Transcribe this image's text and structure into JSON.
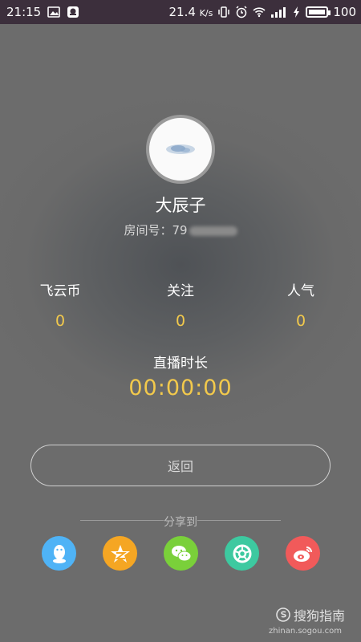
{
  "status_bar": {
    "time": "21:15",
    "net_speed": "21.4",
    "net_unit": "K/s",
    "battery": "100"
  },
  "profile": {
    "name": "大辰子",
    "room_label": "房间号：",
    "room_number_visible": "79"
  },
  "stats": [
    {
      "label": "飞云币",
      "value": "0"
    },
    {
      "label": "关注",
      "value": "0"
    },
    {
      "label": "人气",
      "value": "0"
    }
  ],
  "duration": {
    "label": "直播时长",
    "value": "00:00:00"
  },
  "back_button": {
    "label": "返回"
  },
  "share": {
    "label": "分享到",
    "targets": [
      {
        "name": "qq-icon",
        "color": "#4fb3f6"
      },
      {
        "name": "qzone-icon",
        "color": "#f5a623"
      },
      {
        "name": "wechat-icon",
        "color": "#7ad03a"
      },
      {
        "name": "moments-icon",
        "color": "#3dc9a0"
      },
      {
        "name": "weibo-icon",
        "color": "#f15a5a"
      }
    ]
  },
  "watermark": {
    "brand": "搜狗指南",
    "url": "zhinan.sogou.com"
  },
  "colors": {
    "accent_yellow": "#f2c94c",
    "status_bar": "#3c2f3c"
  }
}
